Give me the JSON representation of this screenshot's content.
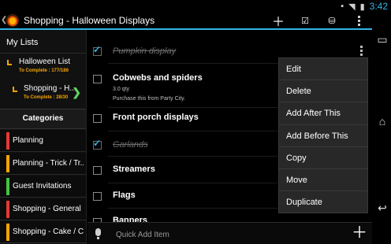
{
  "status_bar": {
    "time": "3:42",
    "icons": [
      "sim-icon",
      "wifi-icon",
      "battery-icon"
    ]
  },
  "action_bar": {
    "title": "Shopping - Halloween Displays",
    "icons": [
      "pumpkin-app-icon",
      "add-icon",
      "checklist-icon",
      "database-icon",
      "overflow-icon"
    ]
  },
  "sidebar": {
    "header": "My Lists",
    "lists": [
      {
        "name": "Halloween List",
        "progress": "To Complete : 177/186"
      },
      {
        "name": "Shopping - H...",
        "progress": "To Complete : 28/30"
      }
    ],
    "categories_title": "Categories",
    "categories": [
      {
        "label": "Planning",
        "color": "#e53935"
      },
      {
        "label": "Planning - Trick / Tr...",
        "color": "#f6a500"
      },
      {
        "label": "Guest Invitations",
        "color": "#43c43f"
      },
      {
        "label": "Shopping - General",
        "color": "#e53935"
      },
      {
        "label": "Shopping - Cake / C...",
        "color": "#f6a500"
      }
    ]
  },
  "items": [
    {
      "title": "Pumpkin display",
      "checked": true
    },
    {
      "title": "Cobwebs and spiders",
      "checked": false,
      "qty": "3.0 qty",
      "note": "Purchase this from Party City."
    },
    {
      "title": "Front porch displays",
      "checked": false
    },
    {
      "title": "Garlands",
      "checked": true
    },
    {
      "title": "Streamers",
      "checked": false
    },
    {
      "title": "Flags",
      "checked": false
    },
    {
      "title": "Banners",
      "checked": false
    }
  ],
  "quick_add": {
    "placeholder": "Quick Add Item"
  },
  "context_menu": {
    "items": [
      "Edit",
      "Delete",
      "Add After This",
      "Add Before This",
      "Copy",
      "Move",
      "Duplicate"
    ]
  },
  "nav_bar": {
    "icons": [
      "recent-apps-icon",
      "home-icon",
      "back-icon"
    ]
  },
  "colors": {
    "accent": "#33b5e5",
    "list_indicator": "#f6a500",
    "next_arrow": "#5fd35f"
  }
}
